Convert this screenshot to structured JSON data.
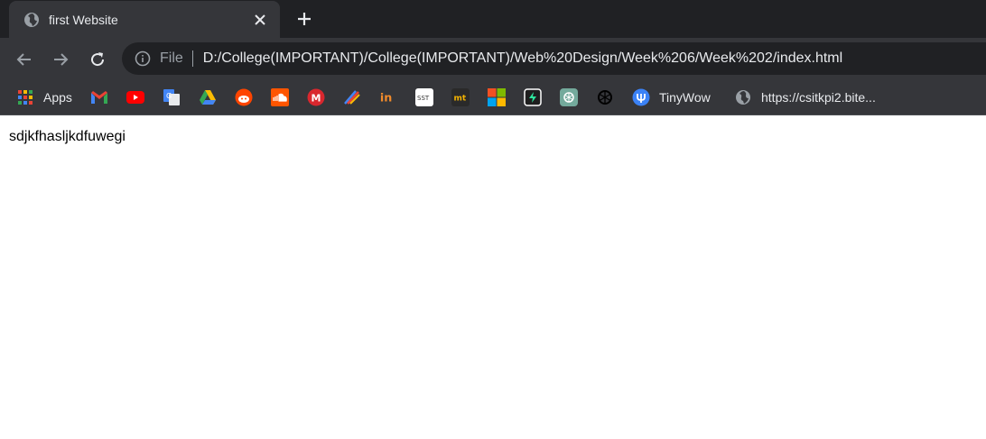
{
  "tab": {
    "title": "first Website",
    "favicon": "globe-icon"
  },
  "toolbar": {
    "scheme_label": "File",
    "url": "D:/College(IMPORTANT)/College(IMPORTANT)/Web%20Design/Week%206/Week%202/index.html"
  },
  "bookmarks": {
    "apps_label": "Apps",
    "tinywow_label": "TinyWow",
    "csit_label": "https://csitkpi2.bite..."
  },
  "page": {
    "body_text": "sdjkfhasljkdfuwegi"
  },
  "colors": {
    "tabstrip_bg": "#202124",
    "toolbar_bg": "#35363a",
    "omnibox_bg": "#202124",
    "text_light": "#e8eaed",
    "text_dim": "#9aa0a6"
  }
}
